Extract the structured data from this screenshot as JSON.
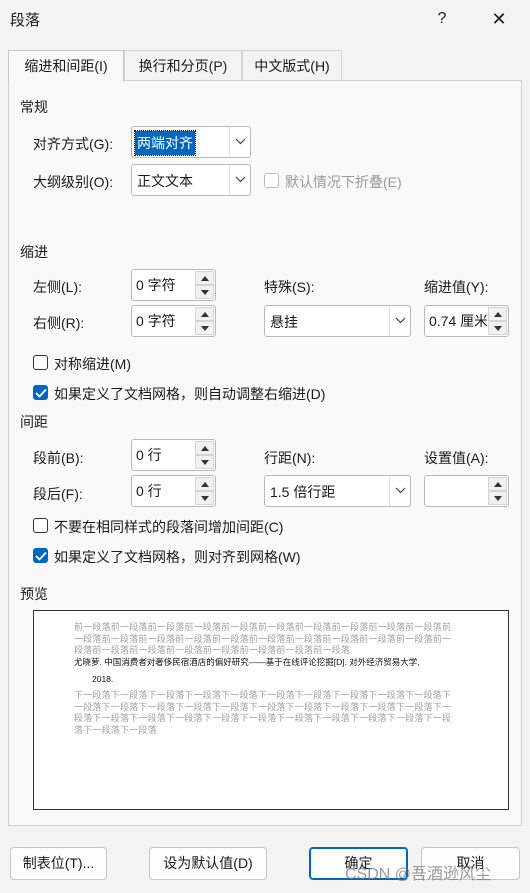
{
  "window": {
    "title": "段落",
    "help": "?",
    "close": "✕"
  },
  "tabs": [
    {
      "label": "缩进和间距(I)"
    },
    {
      "label": "换行和分页(P)"
    },
    {
      "label": "中文版式(H)"
    }
  ],
  "general": {
    "title": "常规",
    "alignment_label": "对齐方式(G):",
    "alignment_value": "两端对齐",
    "outline_label": "大纲级别(O):",
    "outline_value": "正文文本",
    "collapse_label": "默认情况下折叠(E)"
  },
  "indent": {
    "title": "缩进",
    "left_label": "左侧(L):",
    "left_value": "0 字符",
    "right_label": "右侧(R):",
    "right_value": "0 字符",
    "special_label": "特殊(S):",
    "special_value": "悬挂",
    "by_label": "缩进值(Y):",
    "by_value": "0.74 厘米",
    "mirror_label": "对称缩进(M)",
    "mirror_checked": false,
    "auto_adjust_label": "如果定义了文档网格，则自动调整右缩进(D)",
    "auto_adjust_checked": true
  },
  "spacing": {
    "title": "间距",
    "before_label": "段前(B):",
    "before_value": "0 行",
    "after_label": "段后(F):",
    "after_value": "0 行",
    "line_label": "行距(N):",
    "line_value": "1.5 倍行距",
    "at_label": "设置值(A):",
    "at_value": "",
    "no_space_label": "不要在相同样式的段落间增加间距(C)",
    "no_space_checked": false,
    "snap_label": "如果定义了文档网格，则对齐到网格(W)",
    "snap_checked": true
  },
  "preview": {
    "title": "预览",
    "prev_text": "前一段落前一段落前一段落前一段落前一段落前一段落前一段落前一段落前一段落前一段落前一段落前一段落前一段落前一段落前一段落前一段落前一段落前一段落前一段落前一段落前一段落前一段落前一段落前一段落前一段落前一段落前一段落前一段落",
    "sample_line1": "尤晓萝. 中国消费者对奢侈民宿酒店的偏好研究——基于在线评论挖掘[D]. 对外经济贸易大学,",
    "sample_line2": "2018.",
    "next_text": "下一段落下一段落下一段落下一段落下一段落下一段落下一段落下一段落下一段落下一段落下一段落下一段落下一段落下一段落下一段落下一段落下一段落下一段落下一段落下一段落下一段落下一段落下一段落下一段落下一段落下一段落下一段落下一段落下一段落下一段落下一段落下一段落下一段落"
  },
  "buttons": {
    "tabs": "制表位(T)...",
    "default": "设为默认值(D)",
    "ok": "确定",
    "cancel": "取消"
  },
  "watermark": "CSDN @吾酒逊风尘"
}
